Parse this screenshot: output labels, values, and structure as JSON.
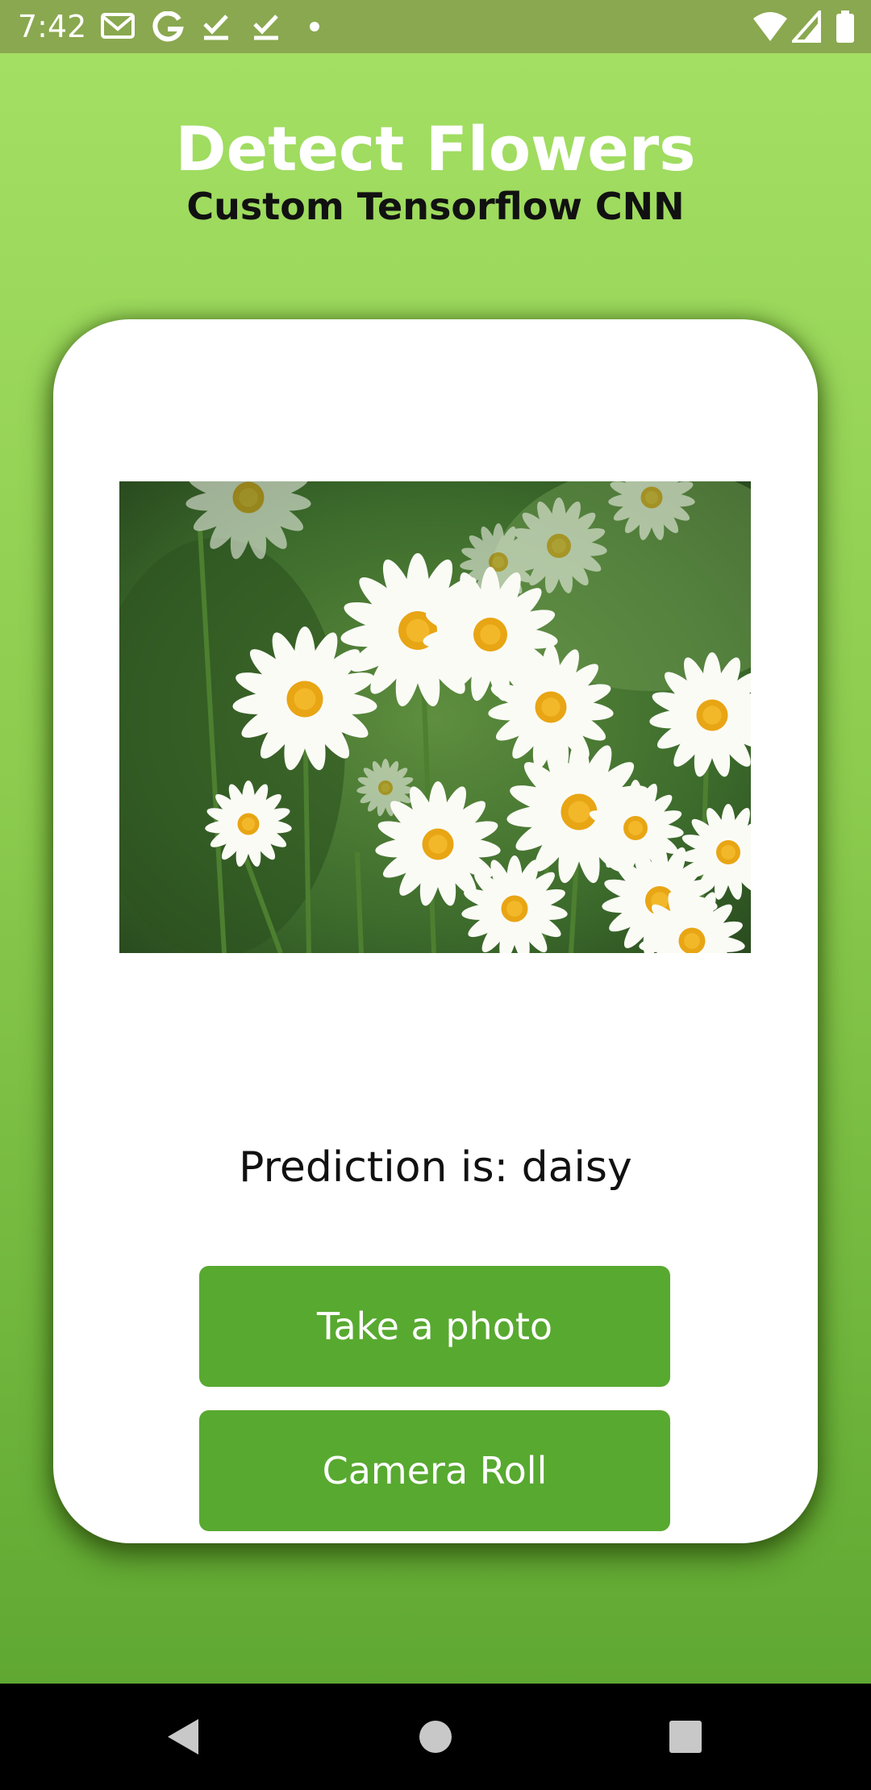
{
  "status_bar": {
    "time": "7:42",
    "left_icons": [
      "gmail-icon",
      "google-icon",
      "check-icon",
      "check-icon",
      "dot-icon"
    ],
    "right_icons": [
      "wifi-icon",
      "signal-icon",
      "battery-icon"
    ]
  },
  "header": {
    "title": "Detect Flowers",
    "subtitle": "Custom Tensorflow CNN"
  },
  "card": {
    "image_icon": "daisy-photo",
    "prediction": "Prediction is: daisy",
    "take_photo_label": "Take a photo",
    "camera_roll_label": "Camera Roll"
  },
  "nav_bar": {
    "buttons": [
      "back-icon",
      "home-icon",
      "recents-icon"
    ]
  },
  "colors": {
    "status_bar": "#8aa84f",
    "gradient_top": "#a3df63",
    "gradient_bottom": "#5fa832",
    "button": "#58a930",
    "title": "#ffffff"
  }
}
